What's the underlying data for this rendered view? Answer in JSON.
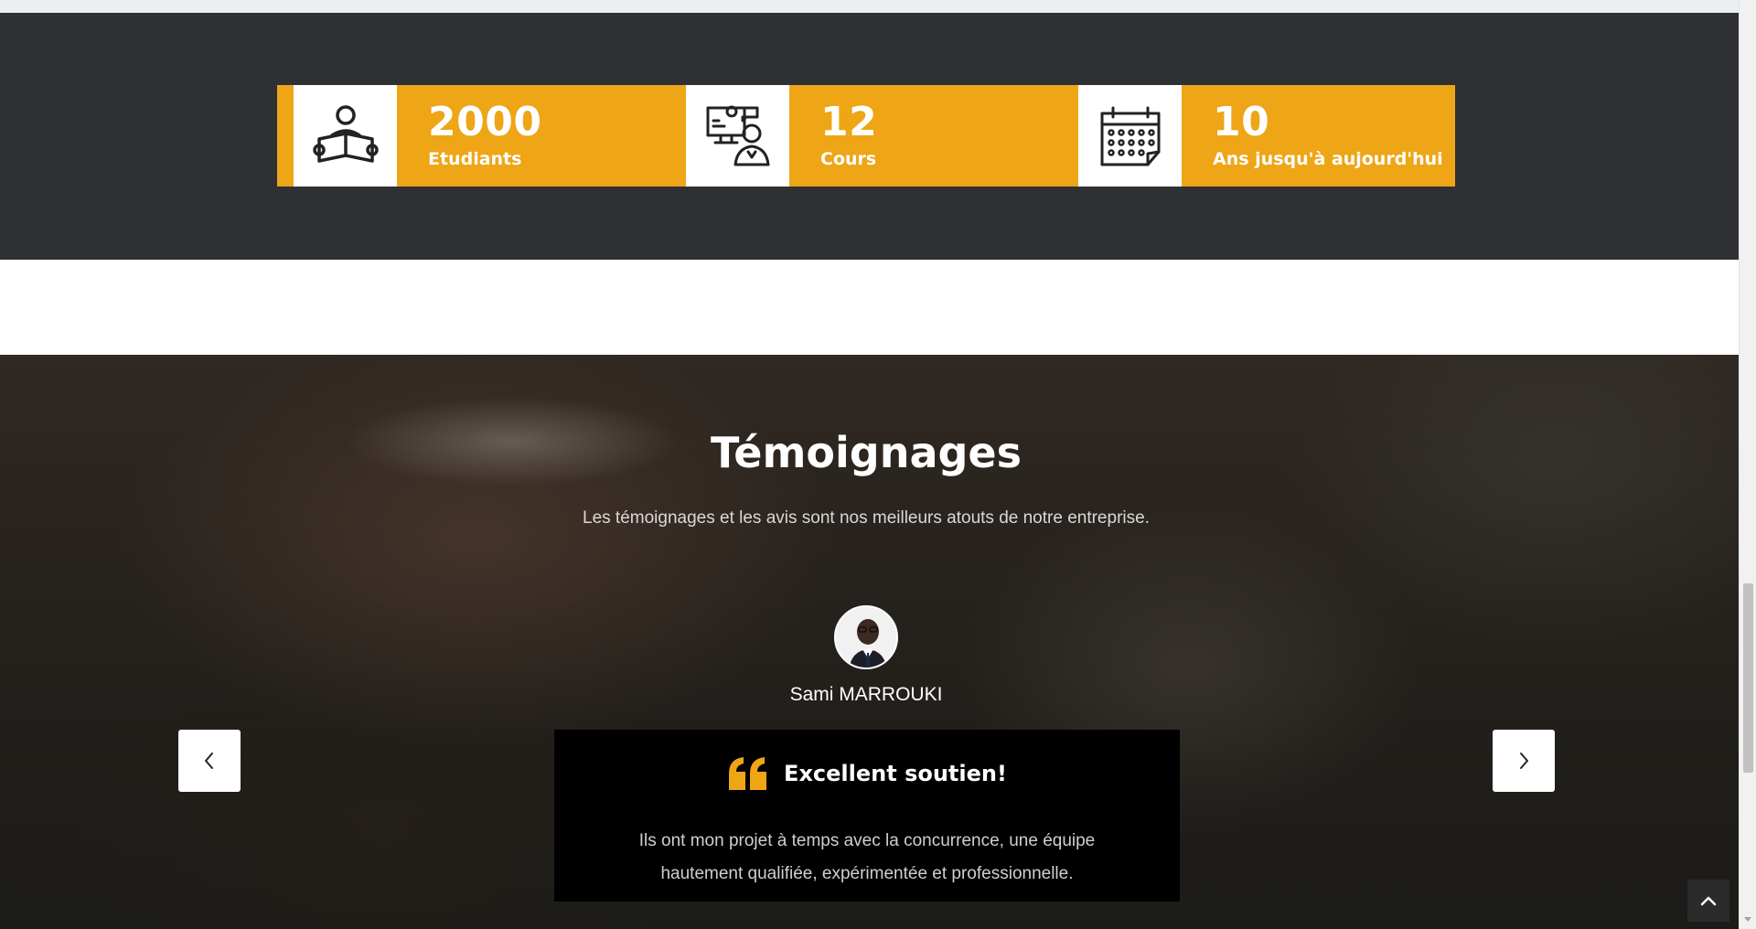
{
  "counters": {
    "items": [
      {
        "number": "2000",
        "label": "Etudiants",
        "icon": "student-reading-icon"
      },
      {
        "number": "12",
        "label": "Cours",
        "icon": "teacher-screen-icon"
      },
      {
        "number": "10",
        "label": "Ans jusqu'à aujourd'hui",
        "icon": "calendar-icon"
      }
    ],
    "accent_color": "#eea516",
    "background_color": "#2e3033"
  },
  "testimonials": {
    "title": "Témoignages",
    "subtitle": "Les témoignages et les avis sont nos meilleurs atouts de notre entreprise.",
    "author": "Sami MARROUKI",
    "quote_title": "Excellent soutien!",
    "quote_text": "Ils ont mon projet à temps avec la concurrence, une équipe hautement qualifiée, expérimentée et professionnelle.",
    "quote_icon": "quote-icon",
    "quote_color": "#eea516",
    "prev_icon": "chevron-left-icon",
    "next_icon": "chevron-right-icon"
  },
  "scroll_top_icon": "chevron-up-icon"
}
